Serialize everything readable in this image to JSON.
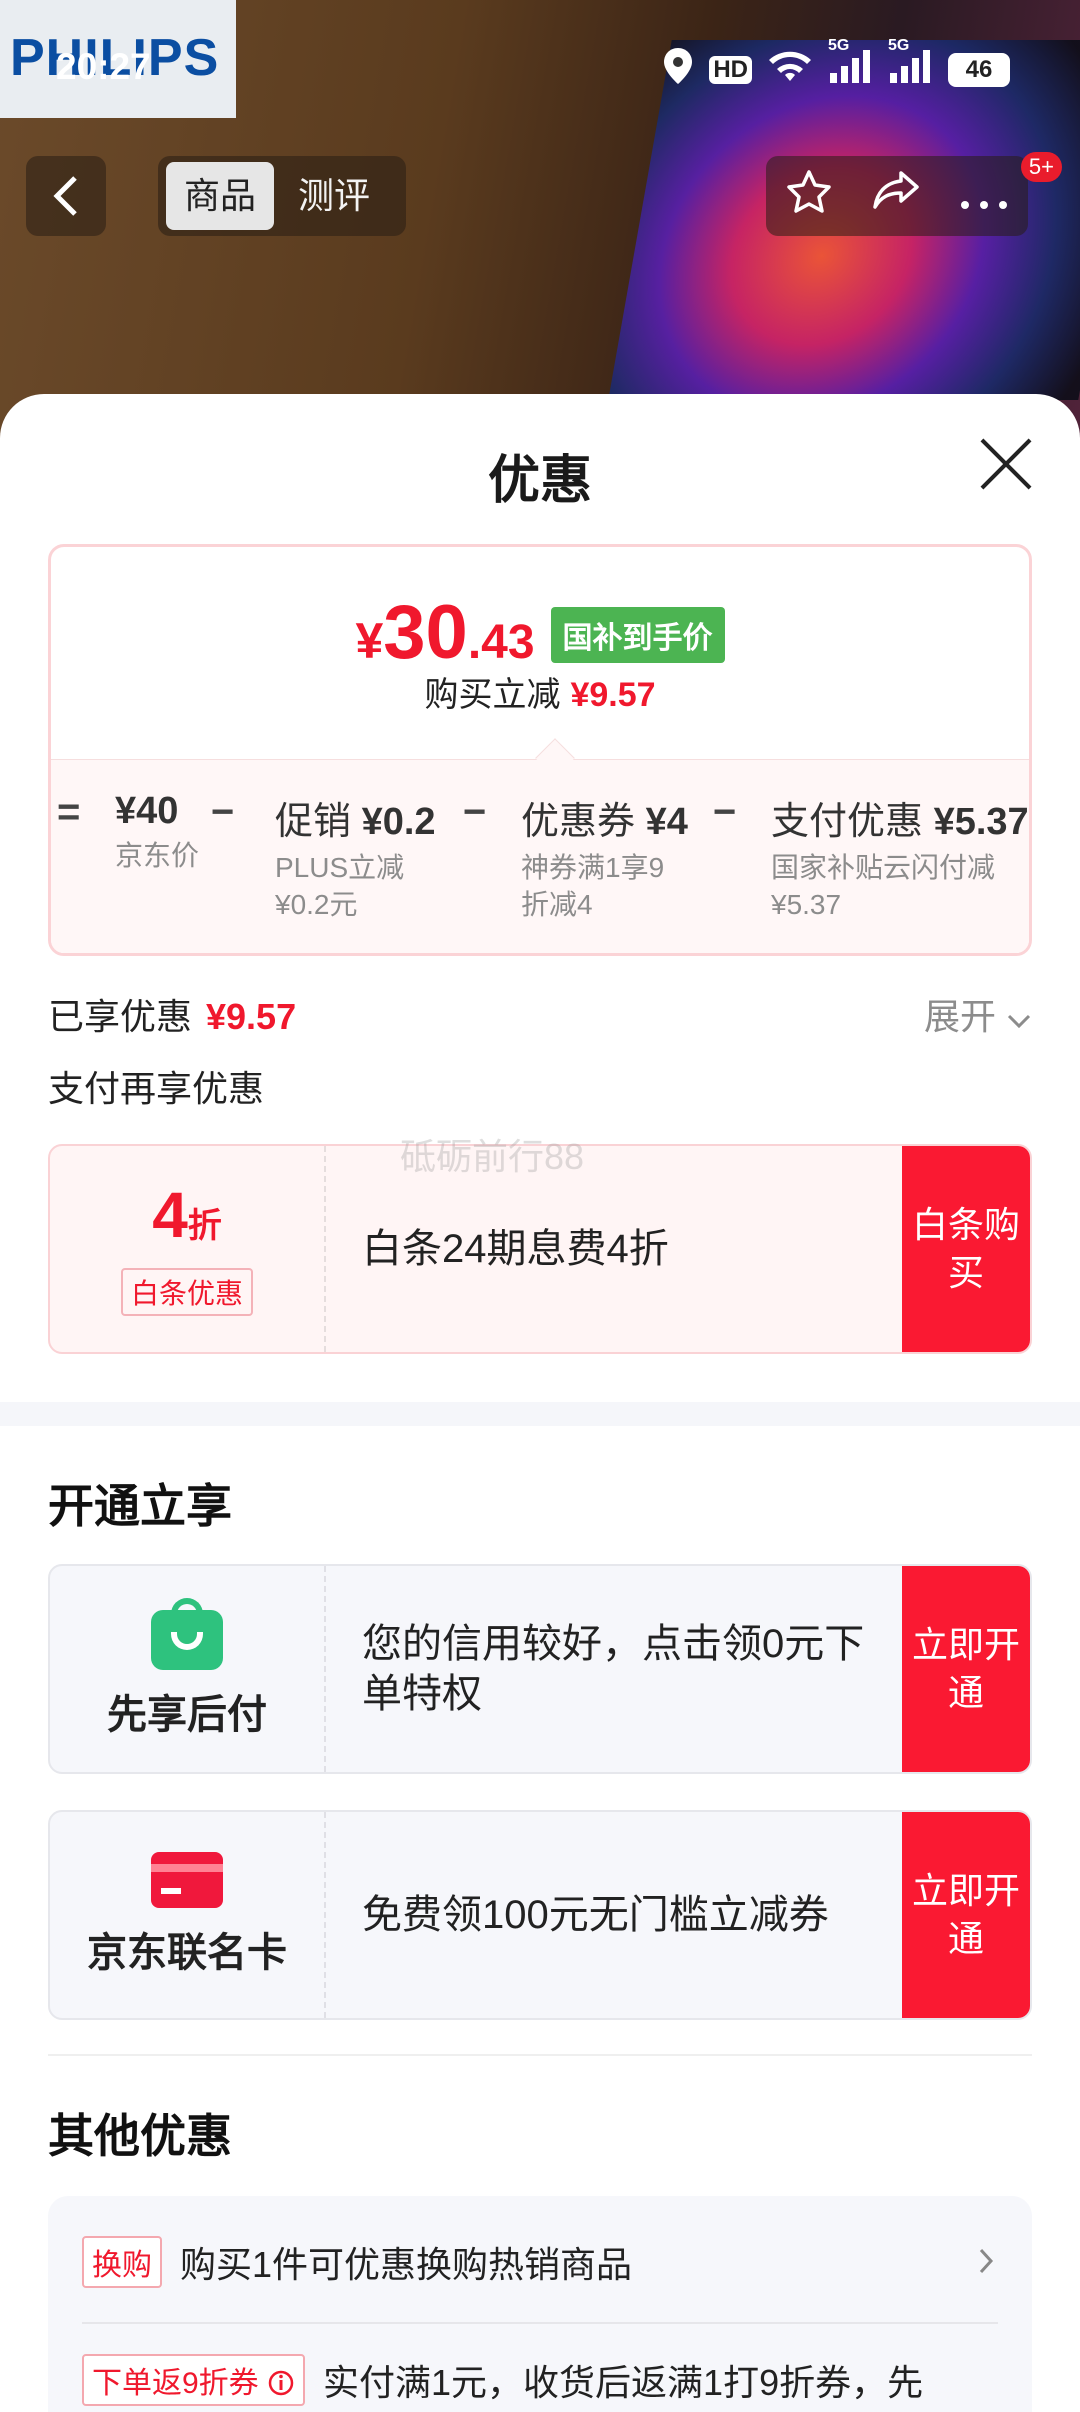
{
  "status_bar": {
    "time": "20:27",
    "hd_label": "HD",
    "sig1": "5G",
    "sig2": "5G",
    "battery": "46"
  },
  "background": {
    "brand_logo": "PHILIPS"
  },
  "topbar": {
    "back_icon": "back-arrow-icon",
    "tabs": [
      {
        "label": "商品",
        "active": true
      },
      {
        "label": "测评",
        "active": false
      }
    ],
    "actions": [
      "star-icon",
      "share-icon",
      "more-icon"
    ],
    "badge": "5+"
  },
  "sheet": {
    "title": "优惠",
    "price": {
      "symbol": "¥",
      "integer": "30",
      "decimal": ".43",
      "tag": "国补到手价"
    },
    "reduce": {
      "label": "购买立减",
      "value": "¥9.57"
    },
    "formula": {
      "eq": "=",
      "minus": "−",
      "terms": [
        {
          "value": "¥40",
          "desc": "京东价"
        },
        {
          "prefix": "促销",
          "value": "¥0.2",
          "desc": "PLUS立减¥0.2元"
        },
        {
          "prefix": "优惠券",
          "value": "¥4",
          "desc": "神券满1享9折减4"
        },
        {
          "prefix": "支付优惠",
          "value": "¥5.37",
          "desc": "国家补贴云闪付减¥5.37"
        }
      ]
    },
    "enjoyed": {
      "label": "已享优惠",
      "value": "¥9.57"
    },
    "expand": "展开",
    "pay_more": "支付再享优惠",
    "watermark": "砥砺前行88",
    "baitiao": {
      "big": "4",
      "unit": "折",
      "tag": "白条优惠",
      "text": "白条24期息费4折",
      "cta": "白条购买"
    },
    "open_section": {
      "title": "开通立享",
      "items": [
        {
          "label": "先享后付",
          "text": "您的信用较好，点击领0元下单特权",
          "cta": "立即开通",
          "icon": "shopping-bag-icon"
        },
        {
          "label": "京东联名卡",
          "text": "免费领100元无门槛立减券",
          "cta": "立即开通",
          "icon": "credit-card-icon"
        }
      ]
    },
    "other_section": {
      "title": "其他优惠",
      "rows": [
        {
          "tag": "换购",
          "text": "购买1件可优惠换购热销商品"
        },
        {
          "tag": "下单返9折券",
          "text": "实付满1元，收货后返满1打9折券，先"
        }
      ]
    }
  }
}
